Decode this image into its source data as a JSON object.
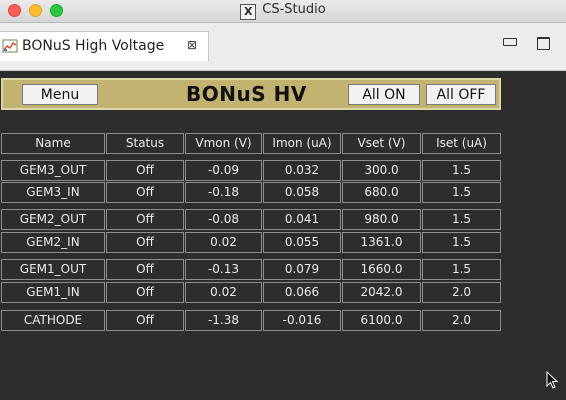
{
  "window": {
    "title": "CS-Studio",
    "x_logo": "X"
  },
  "tab": {
    "label": "BONuS High Voltage",
    "close_glyph": "⊠"
  },
  "header": {
    "menu_label": "Menu",
    "title": "BONuS HV",
    "all_on_label": "All ON",
    "all_off_label": "All OFF",
    "panel_color": "#c3b371"
  },
  "table": {
    "columns": [
      "Name",
      "Status",
      "Vmon (V)",
      "Imon (uA)",
      "Vset (V)",
      "Iset (uA)"
    ],
    "rows": [
      [
        "GEM3_OUT",
        "Off",
        "-0.09",
        "0.032",
        "300.0",
        "1.5"
      ],
      [
        "GEM3_IN",
        "Off",
        "-0.18",
        "0.058",
        "680.0",
        "1.5"
      ],
      [
        "GEM2_OUT",
        "Off",
        "-0.08",
        "0.041",
        "980.0",
        "1.5"
      ],
      [
        "GEM2_IN",
        "Off",
        "0.02",
        "0.055",
        "1361.0",
        "1.5"
      ],
      [
        "GEM1_OUT",
        "Off",
        "-0.13",
        "0.079",
        "1660.0",
        "1.5"
      ],
      [
        "GEM1_IN",
        "Off",
        "0.02",
        "0.066",
        "2042.0",
        "2.0"
      ],
      [
        "CATHODE",
        "Off",
        "-1.38",
        "-0.016",
        "6100.0",
        "2.0"
      ]
    ]
  }
}
